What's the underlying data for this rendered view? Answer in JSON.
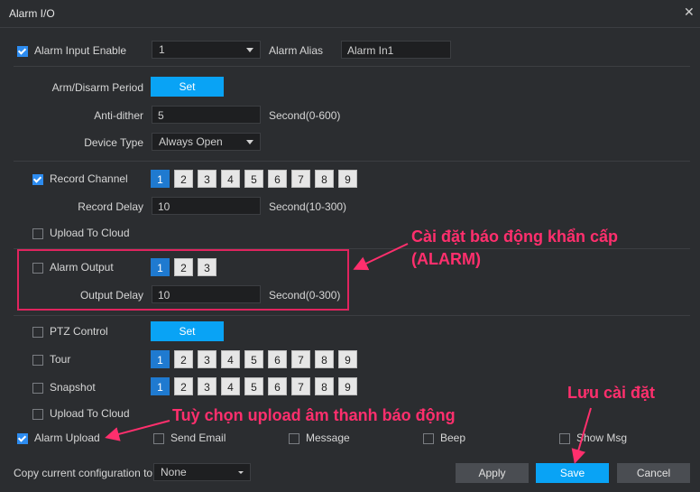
{
  "window": {
    "title": "Alarm I/O"
  },
  "alarm_input": {
    "enable_label": "Alarm Input Enable",
    "enable_checked": true,
    "value": "1",
    "alias_label": "Alarm Alias",
    "alias_value": "Alarm In1"
  },
  "arm_disarm": {
    "label": "Arm/Disarm Period",
    "button": "Set"
  },
  "anti_dither": {
    "label": "Anti-dither",
    "value": "5",
    "unit": "Second(0-600)"
  },
  "device_type": {
    "label": "Device Type",
    "value": "Always Open"
  },
  "record_channel": {
    "label": "Record Channel",
    "checked": true,
    "channels": [
      "1",
      "2",
      "3",
      "4",
      "5",
      "6",
      "7",
      "8",
      "9"
    ],
    "selected": "1"
  },
  "record_delay": {
    "label": "Record Delay",
    "value": "10",
    "unit": "Second(10-300)"
  },
  "upload_cloud_1": {
    "label": "Upload To Cloud",
    "checked": false
  },
  "alarm_output": {
    "label": "Alarm Output",
    "checked": false,
    "channels": [
      "1",
      "2",
      "3"
    ],
    "selected": "1"
  },
  "output_delay": {
    "label": "Output Delay",
    "value": "10",
    "unit": "Second(0-300)"
  },
  "ptz_control": {
    "label": "PTZ Control",
    "checked": false,
    "button": "Set"
  },
  "tour": {
    "label": "Tour",
    "checked": false,
    "channels": [
      "1",
      "2",
      "3",
      "4",
      "5",
      "6",
      "7",
      "8",
      "9"
    ],
    "selected": "1"
  },
  "snapshot": {
    "label": "Snapshot",
    "checked": false,
    "channels": [
      "1",
      "2",
      "3",
      "4",
      "5",
      "6",
      "7",
      "8",
      "9"
    ],
    "selected": "1"
  },
  "upload_cloud_2": {
    "label": "Upload To Cloud",
    "checked": false
  },
  "options": {
    "alarm_upload": "Alarm Upload",
    "send_email": "Send Email",
    "message": "Message",
    "beep": "Beep",
    "show_msg": "Show Msg"
  },
  "footer": {
    "copy_label": "Copy current configuration to",
    "copy_value": "None",
    "apply": "Apply",
    "save": "Save",
    "cancel": "Cancel"
  },
  "annotations": {
    "alarm_setting_line1": "Cài đặt báo động khẩn cấp",
    "alarm_setting_line2": "(ALARM)",
    "upload_option": "Tuỳ chọn upload âm thanh báo động",
    "save_setting": "Lưu cài đặt"
  },
  "colors": {
    "accent": "#09a3f5",
    "annotation": "#ff2f6d",
    "background": "#2b2d30"
  }
}
